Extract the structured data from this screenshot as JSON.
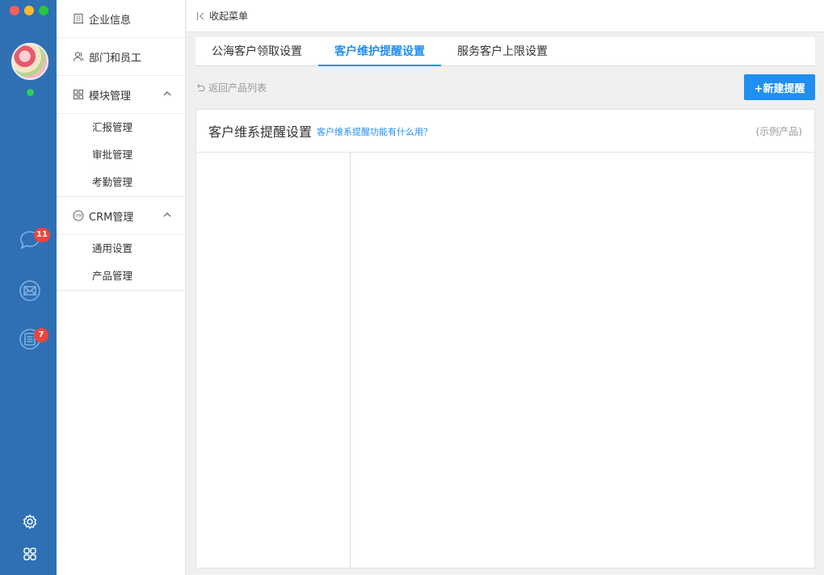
{
  "window": {
    "controls": [
      "close",
      "minimize",
      "maximize"
    ]
  },
  "rail": {
    "status": "online",
    "chat_badge": "11",
    "tasks_badge": "7",
    "icons": [
      "chat-icon",
      "mail-icon",
      "tasks-icon",
      "settings-icon",
      "apps-grid-icon"
    ]
  },
  "sidebar": {
    "company_info": "企业信息",
    "departments": "部门和员工",
    "module_mgmt": "模块管理",
    "module_sub": [
      "汇报管理",
      "审批管理",
      "考勤管理"
    ],
    "crm_mgmt": "CRM管理",
    "crm_sub": [
      "通用设置",
      "产品管理"
    ]
  },
  "topbar": {
    "collapse": "收起菜单"
  },
  "tabs": [
    {
      "label": "公海客户领取设置"
    },
    {
      "label": "客户维护提醒设置"
    },
    {
      "label": "服务客户上限设置"
    }
  ],
  "active_tab": 1,
  "back_link": "返回产品列表",
  "new_button": "+新建提醒",
  "panel": {
    "title": "客户维系提醒设置",
    "help": "客户维系提醒功能有什么用？",
    "note": "(示例产品)"
  },
  "colors": {
    "rail": "#2f6fb3",
    "accent": "#1f8ff0",
    "badge": "#e9463d"
  }
}
